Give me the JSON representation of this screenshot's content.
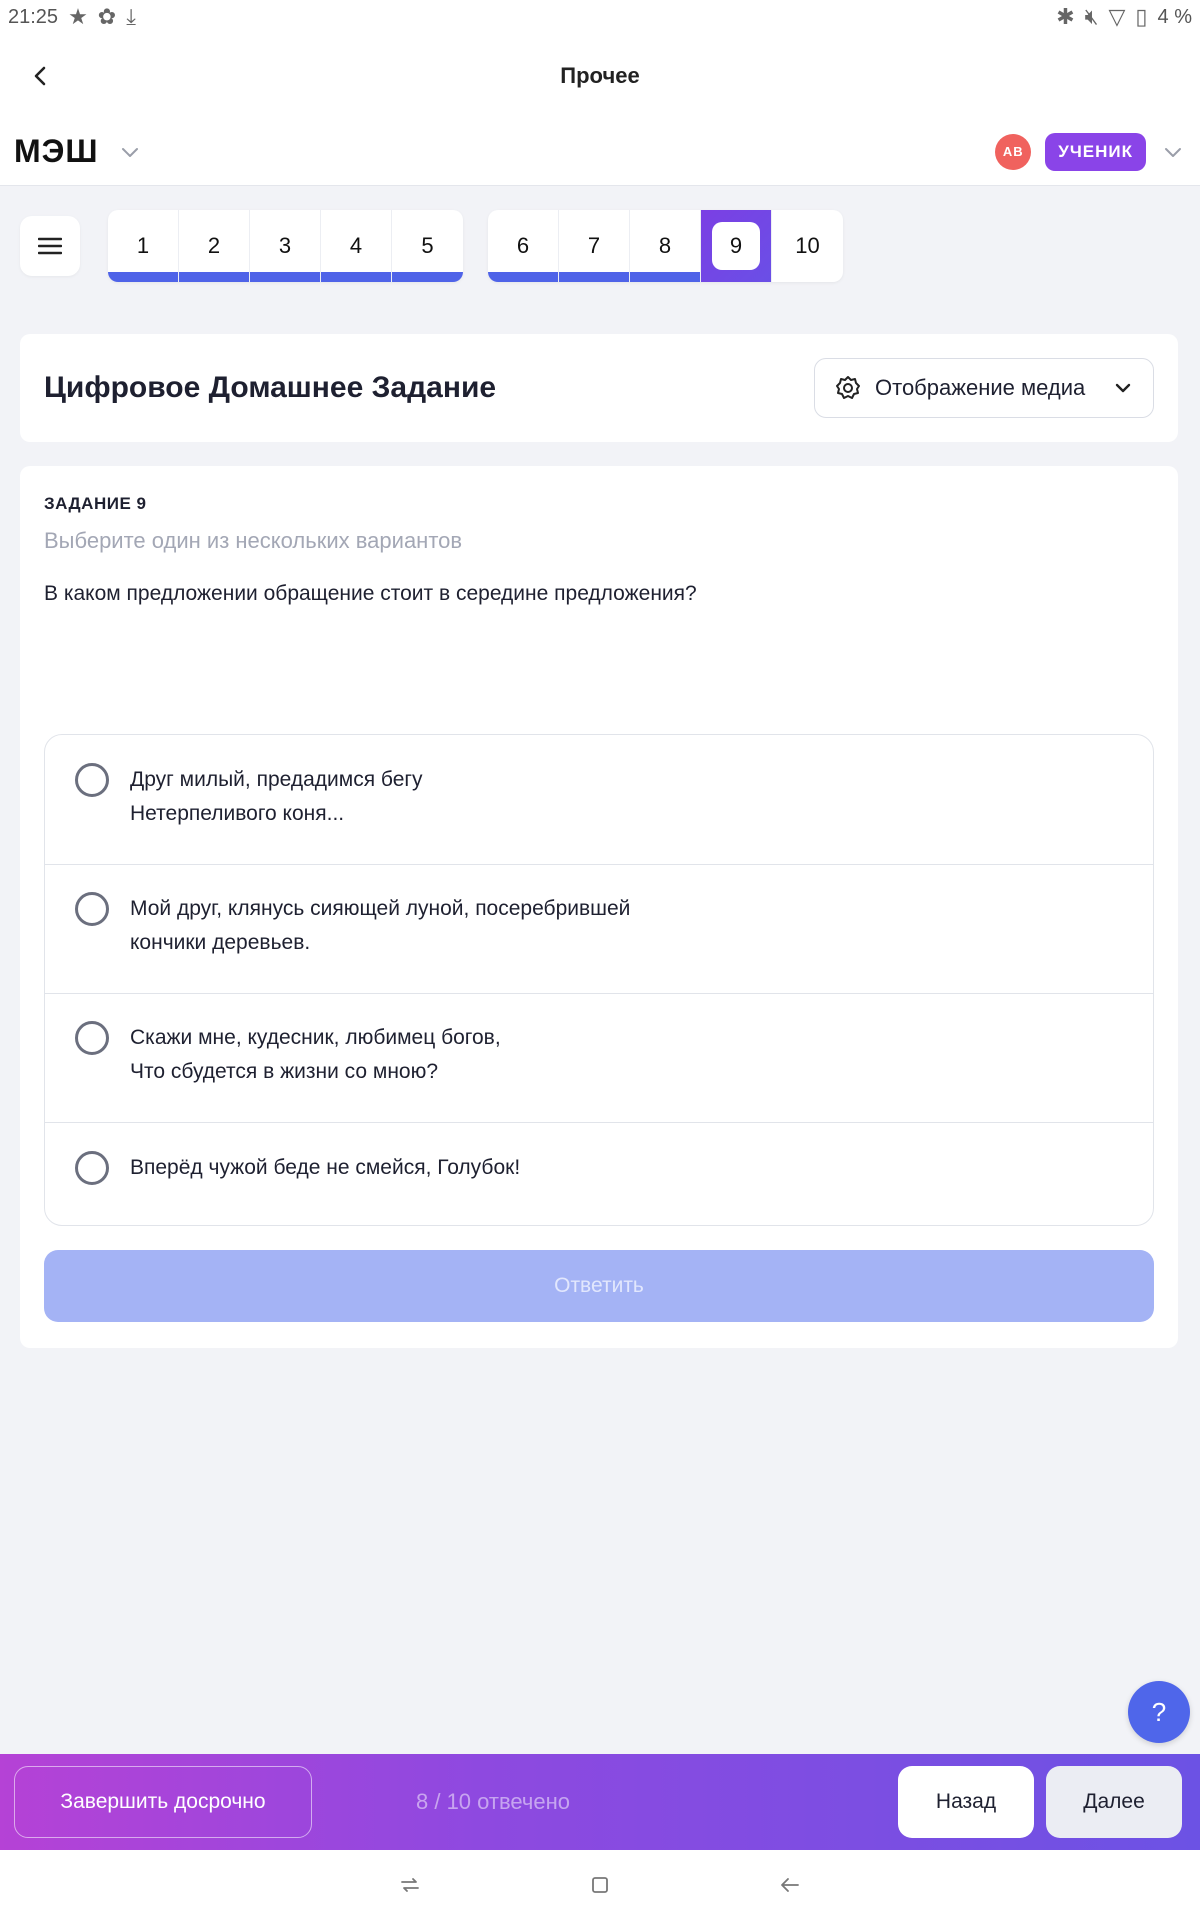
{
  "status_bar": {
    "time": "21:25",
    "battery": "4 %"
  },
  "appbar": {
    "title": "Прочее"
  },
  "brand": {
    "logo": "МЭШ",
    "avatar_initials": "АВ",
    "role": "УЧЕНИК"
  },
  "question_nav": {
    "group1": [
      "1",
      "2",
      "3",
      "4",
      "5"
    ],
    "group2": [
      "6",
      "7",
      "8",
      "9",
      "10"
    ],
    "current": "9"
  },
  "header_card": {
    "title": "Цифровое Домашнее Задание",
    "media_button": "Отображение медиа"
  },
  "task": {
    "label": "ЗАДАНИЕ 9",
    "hint": "Выберите один из нескольких вариантов",
    "question": "В каком предложении обращение стоит в середине предложения?",
    "options": [
      {
        "line1": "Друг милый, предадимся бегу",
        "line2": "Нетерпеливого коня..."
      },
      {
        "line1": "Мой друг, клянусь сияющей луной, посеребрившей",
        "line2": "кончики деревьев."
      },
      {
        "line1": "Скажи мне, кудесник, любимец богов,",
        "line2": "Что сбудется в жизни со мною?"
      },
      {
        "line1": "Вперёд чужой беде не смейся, Голубок!",
        "line2": ""
      }
    ],
    "answer_button": "Ответить"
  },
  "help": {
    "label": "?"
  },
  "bottom_bar": {
    "finish_button": "Завершить досрочно",
    "progress": "8 / 10 отвечено",
    "prev_button": "Назад",
    "next_button": "Далее"
  },
  "colors": {
    "accent": "#4f63e8",
    "brand_purple": "#8a44e8",
    "answer_disabled": "#a4b3f5"
  }
}
